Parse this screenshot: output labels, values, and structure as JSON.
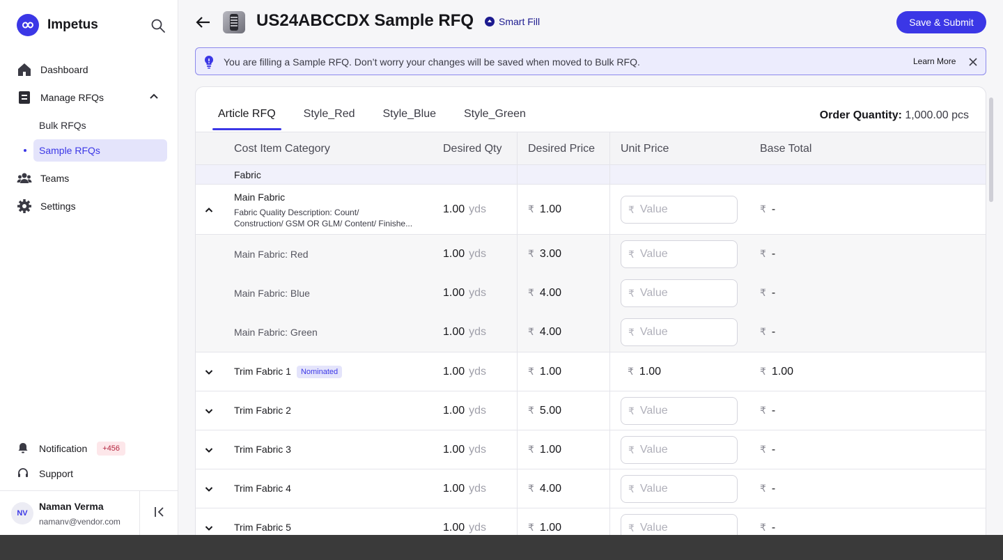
{
  "app": {
    "name": "Impetus",
    "brand_color": "#3b37e6"
  },
  "sidebar": {
    "items": [
      {
        "label": "Dashboard",
        "icon": "home-icon"
      },
      {
        "label": "Manage RFQs",
        "icon": "document-icon",
        "expanded": true,
        "children": [
          {
            "label": "Bulk RFQs"
          },
          {
            "label": "Sample RFQs",
            "active": true
          }
        ]
      },
      {
        "label": "Teams",
        "icon": "users-icon"
      },
      {
        "label": "Settings",
        "icon": "gear-icon"
      }
    ],
    "notification": {
      "label": "Notification",
      "count": "+456"
    },
    "support": {
      "label": "Support"
    },
    "user": {
      "initials": "NV",
      "name": "Naman Verma",
      "email": "namanv@vendor.com"
    }
  },
  "header": {
    "title": "US24ABCCDX Sample RFQ",
    "smart_fill": "Smart Fill",
    "save_label": "Save & Submit"
  },
  "banner": {
    "text": "You are filling a Sample RFQ. Don’t worry your changes will be saved when moved to Bulk RFQ.",
    "link": "Learn More"
  },
  "tabs": [
    {
      "label": "Article RFQ",
      "active": true
    },
    {
      "label": "Style_Red"
    },
    {
      "label": "Style_Blue"
    },
    {
      "label": "Style_Green"
    }
  ],
  "order_quantity": {
    "label": "Order Quantity:",
    "value": "1,000.00 pcs"
  },
  "table": {
    "headers": {
      "category": "Cost Item Category",
      "qty": "Desired Qty",
      "price": "Desired Price",
      "unit": "Unit Price",
      "base": "Base Total"
    },
    "currency": "₹",
    "unit_placeholder": "Value",
    "section": "Fabric",
    "main_row": {
      "name": "Main Fabric",
      "desc1": "Fabric Quality Description: Count/",
      "desc2": "Construction/ GSM OR GLM/ Content/ Finishe...",
      "qty": "1.00",
      "unit": "yds",
      "price": "1.00",
      "base": "-"
    },
    "sub_rows": [
      {
        "name": "Main Fabric: Red",
        "qty": "1.00",
        "unit": "yds",
        "price": "3.00",
        "base": "-"
      },
      {
        "name": "Main Fabric: Blue",
        "qty": "1.00",
        "unit": "yds",
        "price": "4.00",
        "base": "-"
      },
      {
        "name": "Main Fabric: Green",
        "qty": "1.00",
        "unit": "yds",
        "price": "4.00",
        "base": "-"
      }
    ],
    "trim_rows": [
      {
        "name": "Trim Fabric 1",
        "badge": "Nominated",
        "qty": "1.00",
        "unit": "yds",
        "price": "1.00",
        "unit_price": "1.00",
        "base": "1.00"
      },
      {
        "name": "Trim Fabric 2",
        "qty": "1.00",
        "unit": "yds",
        "price": "5.00",
        "base": "-"
      },
      {
        "name": "Trim Fabric 3",
        "qty": "1.00",
        "unit": "yds",
        "price": "1.00",
        "base": "-"
      },
      {
        "name": "Trim Fabric 4",
        "qty": "1.00",
        "unit": "yds",
        "price": "4.00",
        "base": "-"
      },
      {
        "name": "Trim Fabric 5",
        "qty": "1.00",
        "unit": "yds",
        "price": "1.00",
        "base": "-"
      }
    ]
  }
}
